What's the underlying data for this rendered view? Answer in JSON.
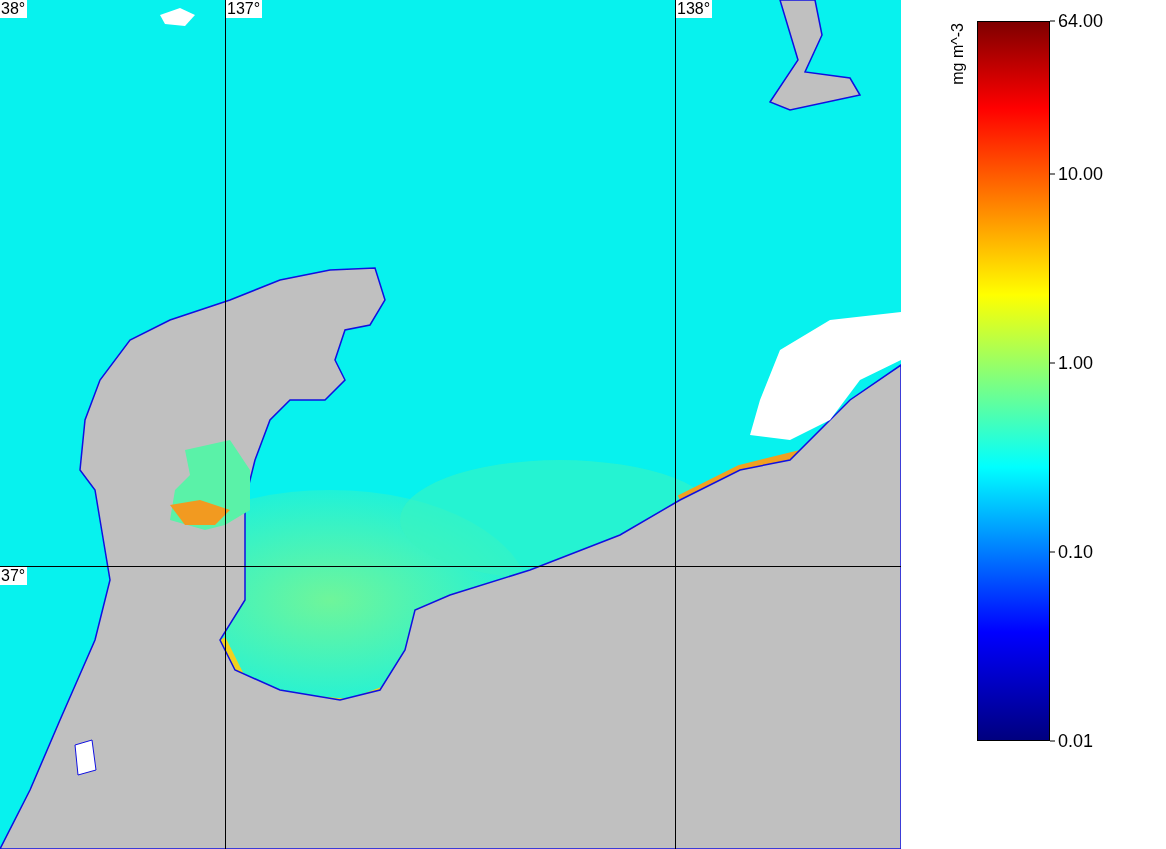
{
  "map": {
    "latitude_labels": [
      "38°",
      "37°"
    ],
    "longitude_labels": [
      "137°",
      "138°"
    ]
  },
  "colorbar": {
    "unit": "mg m^-3",
    "ticks": [
      "64.00",
      "10.00",
      "1.00",
      "0.10",
      "0.01"
    ]
  }
}
